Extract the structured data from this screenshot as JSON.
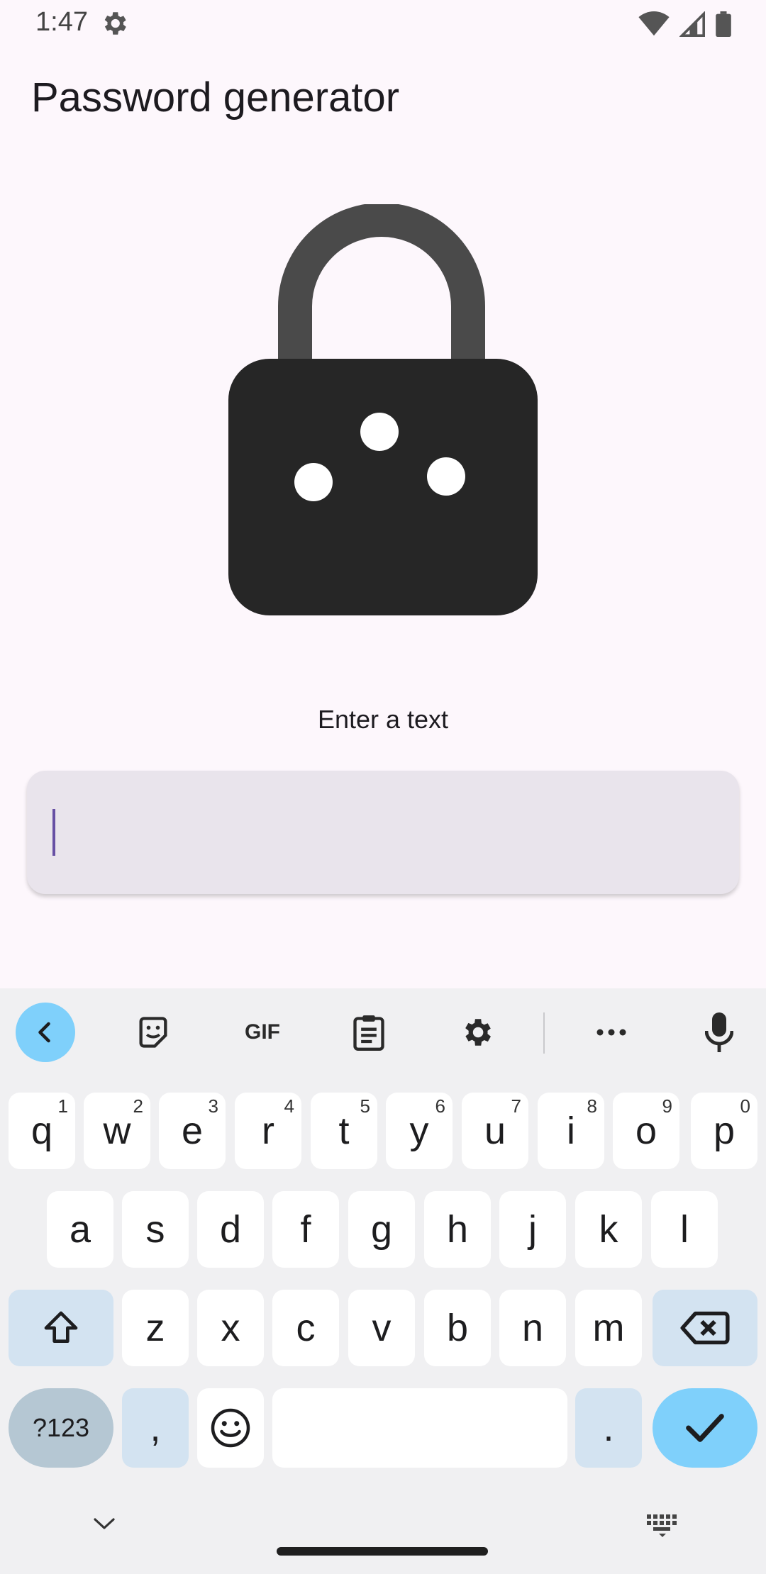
{
  "status_bar": {
    "time": "1:47"
  },
  "app": {
    "title": "Password generator"
  },
  "form": {
    "label": "Enter a text",
    "input_value": "",
    "input_placeholder": ""
  },
  "toolbar": {
    "icons": [
      "chevron-left-icon",
      "sticker-icon",
      "gif-icon",
      "clipboard-icon",
      "settings-icon",
      "more-icon",
      "mic-icon"
    ],
    "gif_label": "GIF"
  },
  "keyboard": {
    "row1": [
      {
        "key": "q",
        "hint": "1"
      },
      {
        "key": "w",
        "hint": "2"
      },
      {
        "key": "e",
        "hint": "3"
      },
      {
        "key": "r",
        "hint": "4"
      },
      {
        "key": "t",
        "hint": "5"
      },
      {
        "key": "y",
        "hint": "6"
      },
      {
        "key": "u",
        "hint": "7"
      },
      {
        "key": "i",
        "hint": "8"
      },
      {
        "key": "o",
        "hint": "9"
      },
      {
        "key": "p",
        "hint": "0"
      }
    ],
    "row2": [
      "a",
      "s",
      "d",
      "f",
      "g",
      "h",
      "j",
      "k",
      "l"
    ],
    "row3": [
      "z",
      "x",
      "c",
      "v",
      "b",
      "n",
      "m"
    ],
    "symbols_label": "?123",
    "comma_label": ",",
    "period_label": "."
  },
  "colors": {
    "accent": "#6750a4",
    "key_accent": "#7fd0fb",
    "modifier_key": "#d3e3f1",
    "lock_body": "#262626",
    "lock_shackle": "#4a4a4a"
  }
}
